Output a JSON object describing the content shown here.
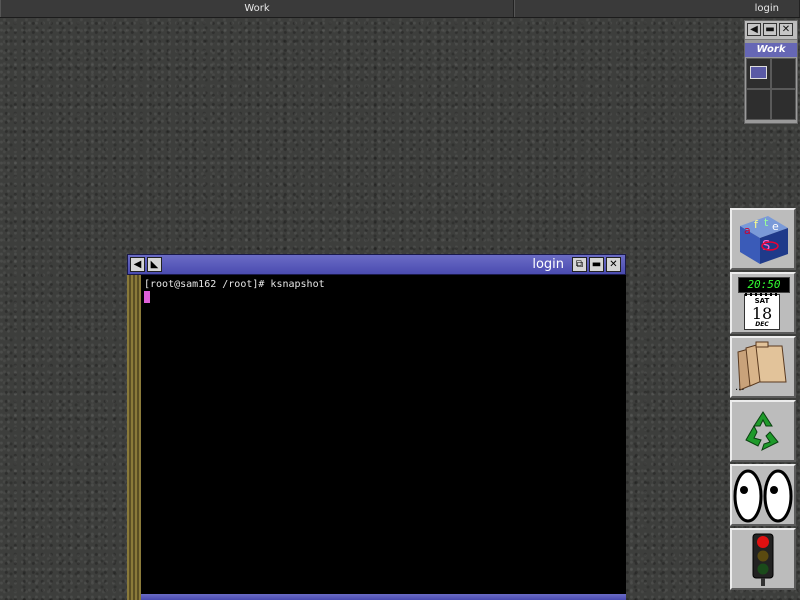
{
  "taskbar": {
    "work_label": "Work",
    "login_label": "login"
  },
  "pager": {
    "desk_label": "Work",
    "window_mini_label": "□"
  },
  "dock": {
    "clock_time": "20:50",
    "calendar_day": "SAT",
    "calendar_date": "18",
    "calendar_month": "DEC",
    "afterstep_label": "afterstep",
    "files_label": "..."
  },
  "terminal": {
    "title": "login",
    "prompt_line": "[root@sam162 /root]# ksnapshot"
  },
  "colors": {
    "title_bar": "#5a5bbd",
    "cursor": "#e060d8",
    "desktop": "#3d3e3c"
  }
}
